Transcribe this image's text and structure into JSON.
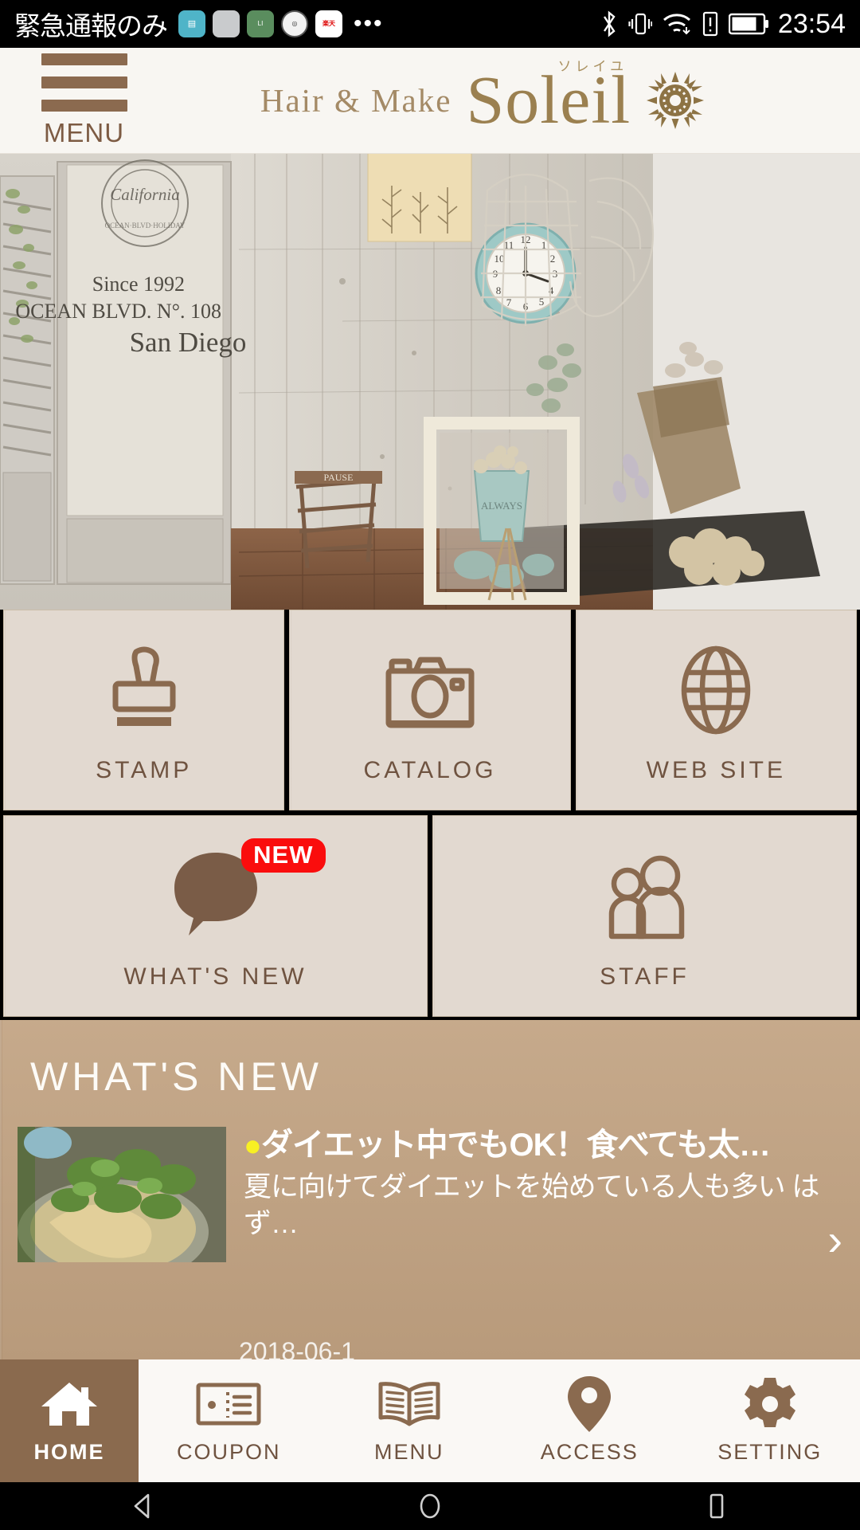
{
  "status_bar": {
    "carrier_text": "緊急通報のみ",
    "notification_icons": [
      "app-icon-blue",
      "app-icon-grey",
      "app-icon-green",
      "app-icon-seal",
      "app-icon-red"
    ],
    "overflow": "•••",
    "right_icons": [
      "bluetooth-icon",
      "vibrate-icon",
      "wifi-icon",
      "sim-alert-icon",
      "battery-icon"
    ],
    "clock": "23:54"
  },
  "app_header": {
    "menu_label": "MENU",
    "logo_prefix": "Hair & Make",
    "logo_name": "Soleil",
    "logo_ruby": "ソレイユ",
    "sun_icon": "sun-icon",
    "background_color": "#f8f6f2",
    "brand_color": "#9b8050"
  },
  "hero": {
    "alt": "salon-interior-photo",
    "sign_line1": "California",
    "sign_line2": "Since 1992",
    "sign_line3": "OCEAN BLVD. N°. 108",
    "sign_line4": "San Diego"
  },
  "tiles": {
    "row1": [
      {
        "label": "STAMP",
        "icon": "stamp-icon",
        "badge": null
      },
      {
        "label": "CATALOG",
        "icon": "camera-icon",
        "badge": null
      },
      {
        "label": "WEB SITE",
        "icon": "globe-icon",
        "badge": null
      }
    ],
    "row2": [
      {
        "label": "WHAT'S NEW",
        "icon": "speech-bubble-icon",
        "badge": "NEW"
      },
      {
        "label": "STAFF",
        "icon": "people-icon",
        "badge": null
      }
    ],
    "badge_color": "#fa0d0d",
    "tile_color": "#e2d9d0",
    "icon_color": "#8a6a4f"
  },
  "whats_new": {
    "section_title": "WHAT'S NEW",
    "item": {
      "bullet": "●",
      "title": "ダイエット中でもOK！食べても太…",
      "body": "夏に向けてダイエットを始めている人も多い はず…",
      "thumbnail": "food-photo-thumbnail",
      "date": "2018-06-1",
      "arrow": "›"
    },
    "background_color": "#c3a585",
    "bullet_color": "#f8f023"
  },
  "bottom_nav": {
    "items": [
      {
        "label": "HOME",
        "icon": "home-icon",
        "active": true
      },
      {
        "label": "COUPON",
        "icon": "ticket-icon",
        "active": false
      },
      {
        "label": "MENU",
        "icon": "book-icon",
        "active": false
      },
      {
        "label": "ACCESS",
        "icon": "map-pin-icon",
        "active": false
      },
      {
        "label": "SETTING",
        "icon": "gear-icon",
        "active": false
      }
    ],
    "active_color": "#8a6a4e",
    "inactive_color": "#6f5340"
  },
  "android_nav": {
    "back": "back-triangle-icon",
    "home": "home-circle-icon",
    "recents": "recents-square-icon"
  }
}
